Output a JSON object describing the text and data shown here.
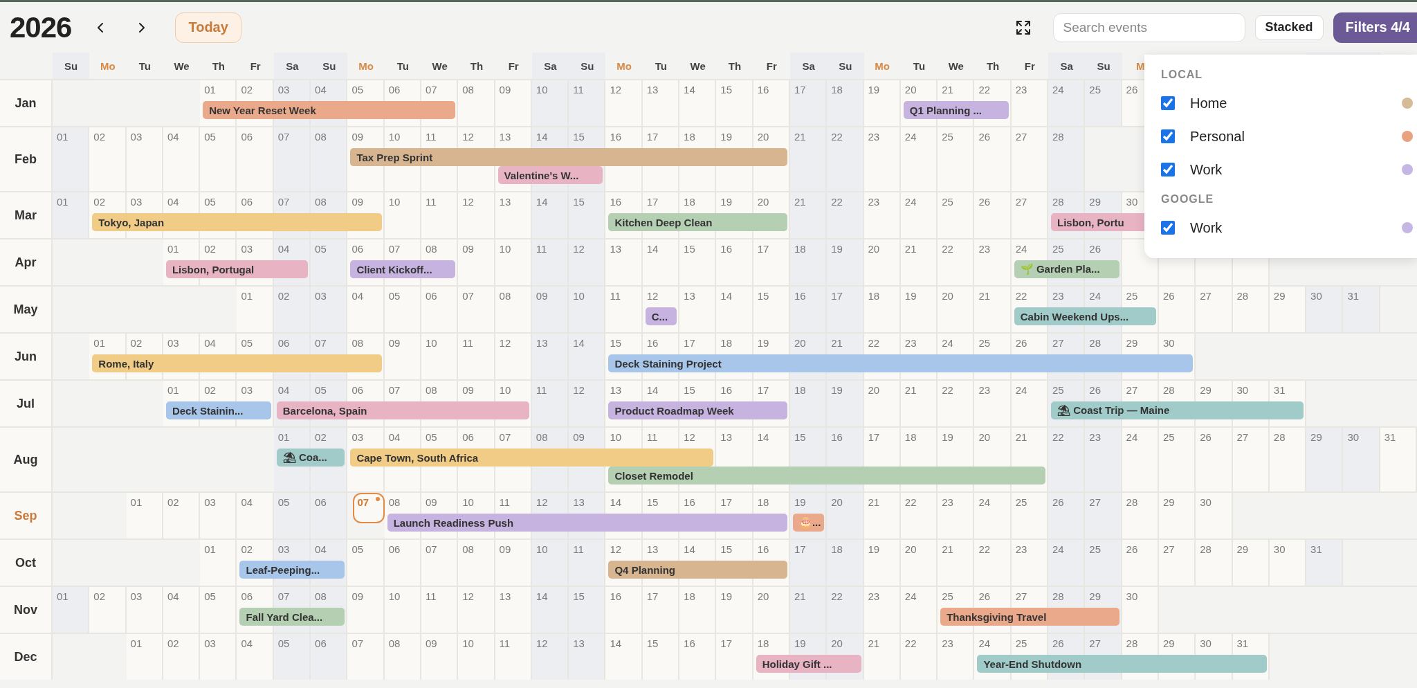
{
  "year": "2026",
  "toolbar": {
    "today_button": "Today",
    "search": {
      "placeholder": "Search events"
    },
    "view_button": "Stacked",
    "filters_button": "Filters 4/4"
  },
  "weekdays": [
    {
      "label": "Su",
      "highlight": false
    },
    {
      "label": "Mo",
      "highlight": true
    },
    {
      "label": "Tu",
      "highlight": false
    },
    {
      "label": "We",
      "highlight": false
    },
    {
      "label": "Th",
      "highlight": false
    },
    {
      "label": "Fr",
      "highlight": false
    },
    {
      "label": "Sa",
      "highlight": false
    },
    {
      "label": "Su",
      "highlight": false
    },
    {
      "label": "Mo",
      "highlight": true
    },
    {
      "label": "Tu",
      "highlight": false
    },
    {
      "label": "We",
      "highlight": false
    },
    {
      "label": "Th",
      "highlight": false
    },
    {
      "label": "Fr",
      "highlight": false
    },
    {
      "label": "Sa",
      "highlight": false
    },
    {
      "label": "Su",
      "highlight": false
    },
    {
      "label": "Mo",
      "highlight": true
    },
    {
      "label": "Tu",
      "highlight": false
    },
    {
      "label": "We",
      "highlight": false
    },
    {
      "label": "Th",
      "highlight": false
    },
    {
      "label": "Fr",
      "highlight": false
    },
    {
      "label": "Sa",
      "highlight": false
    },
    {
      "label": "Su",
      "highlight": false
    },
    {
      "label": "Mo",
      "highlight": true
    },
    {
      "label": "Tu",
      "highlight": false
    },
    {
      "label": "We",
      "highlight": false
    },
    {
      "label": "Th",
      "highlight": false
    },
    {
      "label": "Fr",
      "highlight": false
    },
    {
      "label": "Sa",
      "highlight": false
    },
    {
      "label": "Su",
      "highlight": false
    },
    {
      "label": "M",
      "highlight": true
    }
  ],
  "months": [
    {
      "label": "Jan",
      "current": false,
      "days": [
        "01",
        "02",
        "03",
        "04",
        "05",
        "06",
        "07",
        "08",
        "09",
        "10",
        "11",
        "12",
        "13",
        "14",
        "15",
        "16",
        "17",
        "18",
        "19",
        "20",
        "21",
        "22",
        "23",
        "24",
        "25",
        "26"
      ],
      "events": [
        {
          "title": "New Year Reset Week",
          "color": "#e9a98a"
        },
        {
          "title": "Q1 Planning ...",
          "color": "#c6b3e0"
        }
      ]
    },
    {
      "label": "Feb",
      "current": false,
      "days": [
        "01",
        "02",
        "03",
        "04",
        "05",
        "06",
        "07",
        "08",
        "09",
        "10",
        "11",
        "12",
        "13",
        "14",
        "15",
        "16",
        "17",
        "18",
        "19",
        "20",
        "21",
        "22",
        "23",
        "24",
        "25",
        "26",
        "27",
        "28"
      ],
      "events": [
        {
          "title": "Tax Prep Sprint",
          "color": "#d6b590"
        },
        {
          "title": "Valentine's W...",
          "color": "#e8b4c4"
        }
      ]
    },
    {
      "label": "Mar",
      "current": false,
      "days": [
        "01",
        "02",
        "03",
        "04",
        "05",
        "06",
        "07",
        "08",
        "09",
        "10",
        "11",
        "12",
        "13",
        "14",
        "15",
        "16",
        "17",
        "18",
        "19",
        "20",
        "21",
        "22",
        "23",
        "24",
        "25",
        "26",
        "27",
        "28",
        "29",
        "30"
      ],
      "events": [
        {
          "title": "Tokyo, Japan",
          "color": "#f0cc86"
        },
        {
          "title": "Kitchen Deep Clean",
          "color": "#b4cfb1"
        },
        {
          "title": "Lisbon, Portu",
          "color": "#e8b4c4"
        }
      ]
    },
    {
      "label": "Apr",
      "current": false,
      "days": [
        "01",
        "02",
        "03",
        "04",
        "05",
        "06",
        "07",
        "08",
        "09",
        "10",
        "11",
        "12",
        "13",
        "14",
        "15",
        "16",
        "17",
        "18",
        "19",
        "20",
        "21",
        "22",
        "23",
        "24",
        "25",
        "26"
      ],
      "events": [
        {
          "title": "Lisbon, Portugal",
          "color": "#e8b4c4"
        },
        {
          "title": "Client Kickoff...",
          "color": "#c6b3e0"
        },
        {
          "title": "🌱 Garden Pla...",
          "color": "#b4cfb1"
        }
      ]
    },
    {
      "label": "May",
      "current": false,
      "days": [
        "01",
        "02",
        "03",
        "04",
        "05",
        "06",
        "07",
        "08",
        "09",
        "10",
        "11",
        "12",
        "13",
        "14",
        "15",
        "16",
        "17",
        "18",
        "19",
        "20",
        "21",
        "22",
        "23",
        "24",
        "25",
        "26",
        "27",
        "28",
        "29",
        "30",
        "31"
      ],
      "events": [
        {
          "title": "C...",
          "color": "#c6b3e0"
        },
        {
          "title": "Cabin Weekend Ups...",
          "color": "#a0cbc8"
        }
      ]
    },
    {
      "label": "Jun",
      "current": false,
      "days": [
        "01",
        "02",
        "03",
        "04",
        "05",
        "06",
        "07",
        "08",
        "09",
        "10",
        "11",
        "12",
        "13",
        "14",
        "15",
        "16",
        "17",
        "18",
        "19",
        "20",
        "21",
        "22",
        "23",
        "24",
        "25",
        "26",
        "27",
        "28",
        "29",
        "30"
      ],
      "events": [
        {
          "title": "Rome, Italy",
          "color": "#f0cc86"
        },
        {
          "title": "Deck Staining Project",
          "color": "#a8c6ea"
        }
      ]
    },
    {
      "label": "Jul",
      "current": false,
      "days": [
        "01",
        "02",
        "03",
        "04",
        "05",
        "06",
        "07",
        "08",
        "09",
        "10",
        "11",
        "12",
        "13",
        "14",
        "15",
        "16",
        "17",
        "18",
        "19",
        "20",
        "21",
        "22",
        "23",
        "24",
        "25",
        "26",
        "27",
        "28",
        "29",
        "30",
        "31"
      ],
      "events": [
        {
          "title": "Deck Stainin...",
          "color": "#a8c6ea"
        },
        {
          "title": "Barcelona, Spain",
          "color": "#e8b4c4"
        },
        {
          "title": "Product Roadmap Week",
          "color": "#c6b3e0"
        },
        {
          "title": "⛱ Coast Trip — Maine",
          "color": "#a0cbc8"
        }
      ]
    },
    {
      "label": "Aug",
      "current": false,
      "days": [
        "01",
        "02",
        "03",
        "04",
        "05",
        "06",
        "07",
        "08",
        "09",
        "10",
        "11",
        "12",
        "13",
        "14",
        "15",
        "16",
        "17",
        "18",
        "19",
        "20",
        "21",
        "22",
        "23",
        "24",
        "25",
        "26",
        "27",
        "28",
        "29",
        "30",
        "31"
      ],
      "events": [
        {
          "title": "⛱ Coa...",
          "color": "#a0cbc8"
        },
        {
          "title": "Cape Town, South Africa",
          "color": "#f0cc86"
        },
        {
          "title": "Closet Remodel",
          "color": "#b4cfb1"
        }
      ]
    },
    {
      "label": "Sep",
      "current": true,
      "days": [
        "01",
        "02",
        "03",
        "04",
        "05",
        "06"
      ],
      "today": "07",
      "days_after": [
        "08",
        "09",
        "10",
        "11",
        "12",
        "13",
        "14",
        "15",
        "16",
        "17",
        "18",
        "19",
        "20",
        "21",
        "22",
        "23",
        "24",
        "25",
        "26",
        "27",
        "28",
        "29",
        "30"
      ],
      "events": [
        {
          "title": "Launch Readiness Push",
          "color": "#c6b3e0"
        },
        {
          "title": "🎂...",
          "color": "#e9a98a"
        }
      ]
    },
    {
      "label": "Oct",
      "current": false,
      "days": [
        "01",
        "02",
        "03",
        "04",
        "05",
        "06",
        "07",
        "08",
        "09",
        "10",
        "11",
        "12",
        "13",
        "14",
        "15",
        "16",
        "17",
        "18",
        "19",
        "20",
        "21",
        "22",
        "23",
        "24",
        "25",
        "26",
        "27",
        "28",
        "29",
        "30",
        "31"
      ],
      "events": [
        {
          "title": "Leaf-Peeping...",
          "color": "#a8c6ea"
        },
        {
          "title": "Q4 Planning",
          "color": "#d6b590"
        }
      ]
    },
    {
      "label": "Nov",
      "current": false,
      "days": [
        "01",
        "02",
        "03",
        "04",
        "05",
        "06",
        "07",
        "08",
        "09",
        "10",
        "11",
        "12",
        "13",
        "14",
        "15",
        "16",
        "17",
        "18",
        "19",
        "20",
        "21",
        "22",
        "23",
        "24",
        "25",
        "26",
        "27",
        "28",
        "29",
        "30"
      ],
      "events": [
        {
          "title": "Fall Yard Clea...",
          "color": "#b4cfb1"
        },
        {
          "title": "Thanksgiving Travel",
          "color": "#e9a98a"
        }
      ]
    },
    {
      "label": "Dec",
      "current": false,
      "days": [
        "01",
        "02",
        "03",
        "04",
        "05",
        "06",
        "07",
        "08",
        "09",
        "10",
        "11",
        "12",
        "13",
        "14",
        "15",
        "16",
        "17",
        "18",
        "19",
        "20",
        "21",
        "22",
        "23",
        "24",
        "25",
        "26",
        "27",
        "28",
        "29",
        "30",
        "31"
      ],
      "events": [
        {
          "title": "Holiday Gift ...",
          "color": "#e8b4c4"
        },
        {
          "title": "Year-End Shutdown",
          "color": "#a0cbc8"
        }
      ]
    }
  ],
  "filters": {
    "groups": [
      {
        "title": "LOCAL",
        "items": [
          {
            "label": "Home",
            "checked": true,
            "color": "#d6bb97"
          },
          {
            "label": "Personal",
            "checked": true,
            "color": "#e9a27f"
          },
          {
            "label": "Work",
            "checked": true,
            "color": "#c6b6e3"
          }
        ]
      },
      {
        "title": "GOOGLE",
        "items": [
          {
            "label": "Work",
            "checked": true,
            "color": "#c6b6e3"
          }
        ]
      }
    ]
  }
}
